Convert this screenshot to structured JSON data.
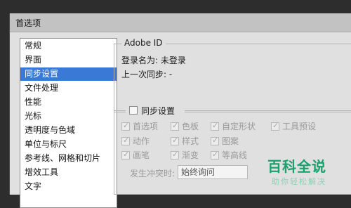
{
  "window": {
    "title": "首选项"
  },
  "sidebar": {
    "items": [
      {
        "label": "常规"
      },
      {
        "label": "界面"
      },
      {
        "label": "同步设置",
        "selected": true
      },
      {
        "label": "文件处理"
      },
      {
        "label": "性能"
      },
      {
        "label": "光标"
      },
      {
        "label": "透明度与色域"
      },
      {
        "label": "单位与标尺"
      },
      {
        "label": "参考线、网格和切片"
      },
      {
        "label": "增效工具"
      },
      {
        "label": "文字"
      }
    ]
  },
  "adobe_id": {
    "title": "Adobe ID",
    "login_label": "登录名为: 未登录",
    "last_sync_label": "上一次同步: -"
  },
  "sync": {
    "checkbox_label": "同步设置",
    "checkbox_checked": false,
    "options": [
      {
        "label": "首选项",
        "checked": true
      },
      {
        "label": "色板",
        "checked": true
      },
      {
        "label": "自定形状",
        "checked": true
      },
      {
        "label": "工具预设",
        "checked": true
      },
      {
        "label": "动作",
        "checked": true
      },
      {
        "label": "样式",
        "checked": true
      },
      {
        "label": "图案",
        "checked": true
      },
      {
        "label": "画笔",
        "checked": true
      },
      {
        "label": "渐变",
        "checked": true
      },
      {
        "label": "等高线",
        "checked": true
      }
    ],
    "conflict_label": "发生冲突时:",
    "conflict_value": "始终询问"
  },
  "watermark": {
    "title": "百科全说",
    "subtitle": "助你轻松解决"
  }
}
